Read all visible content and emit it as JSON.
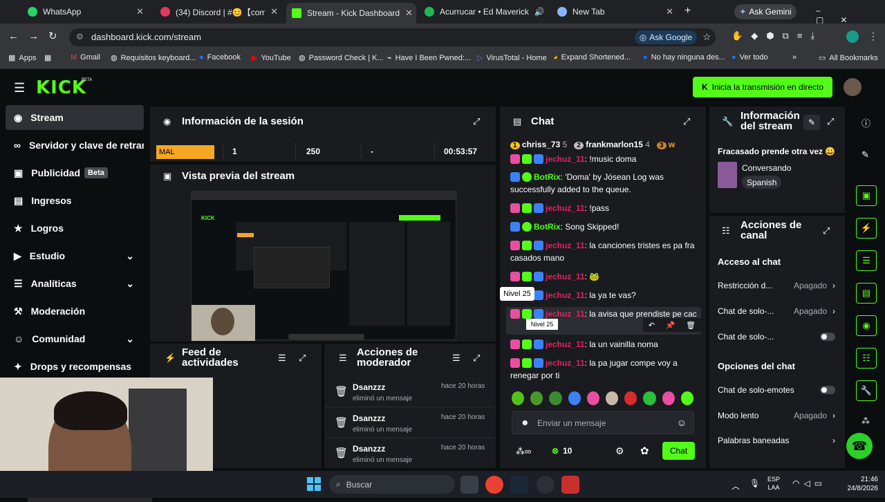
{
  "tabs": [
    {
      "title": "WhatsApp",
      "color": "#25d366"
    },
    {
      "title": "(34) Discord | #😊【comunid",
      "color": "#e2395b"
    },
    {
      "title": "Stream - Kick Dashboard",
      "color": "#53fc18"
    },
    {
      "title": "Acurrucar • Ed Maverick",
      "color": "#1db954"
    },
    {
      "title": "New Tab",
      "color": "#8ab4f8"
    }
  ],
  "ask_gemini": "Ask Gemini",
  "url": "dashboard.kick.com/stream",
  "ask_google": "Ask Google",
  "bookmarks": [
    "Apps",
    "Gmail",
    "Requisitos keyboard...",
    "Facebook",
    "YouTube",
    "Password Check | K...",
    "Have I Been Pwned:...",
    "VirusTotal - Home",
    "Expand Shortened...",
    "No hay ninguna des...",
    "Ver todo"
  ],
  "all_bookmarks": "All Bookmarks",
  "kick_logo": "KICK",
  "beta_tag": "BETA",
  "go_live": "Inicia la transmisión en directo",
  "sidebar": [
    {
      "label": "Stream",
      "icon": "stream-icon",
      "glyph": "◉"
    },
    {
      "label": "Servidor y clave de retransmisi",
      "icon": "link-icon",
      "glyph": "∞"
    },
    {
      "label": "Publicidad",
      "icon": "ad-icon",
      "glyph": "▣",
      "badge": "Beta"
    },
    {
      "label": "Ingresos",
      "icon": "revenue-icon",
      "glyph": "▤"
    },
    {
      "label": "Logros",
      "icon": "trophy-icon",
      "glyph": "★"
    },
    {
      "label": "Estudio",
      "icon": "studio-icon",
      "glyph": "▶"
    },
    {
      "label": "Analíticas",
      "icon": "analytics-icon",
      "glyph": "☰"
    },
    {
      "label": "Moderación",
      "icon": "moderation-icon",
      "glyph": "⚒"
    },
    {
      "label": "Comunidad",
      "icon": "community-icon",
      "glyph": "☺"
    },
    {
      "label": "Drops y recompensas",
      "icon": "gift-icon",
      "glyph": "✦"
    }
  ],
  "session": {
    "title": "Información de la sesión",
    "quality": "MAL",
    "viewers": "1",
    "followers": "250",
    "subs": "-",
    "uptime": "00:53:57"
  },
  "preview": {
    "title": "Vista previa del stream"
  },
  "feed": {
    "title1": "Feed de",
    "title2": "actividades"
  },
  "modactions": {
    "title1": "Acciones de",
    "title2": "moderador",
    "items": [
      {
        "user": "Dsanzzz",
        "action": "eliminó un mensaje",
        "time": "hace 20 horas"
      },
      {
        "user": "Dsanzzz",
        "action": "eliminó un mensaje",
        "time": "hace 20 horas"
      },
      {
        "user": "Dsanzzz",
        "action": "eliminó un mensaje",
        "time": "hace 20 horas"
      }
    ]
  },
  "chat": {
    "title": "Chat",
    "top": [
      {
        "rank": "1",
        "user": "chriss_73",
        "count": "5"
      },
      {
        "rank": "2",
        "user": "frankmarlon15",
        "count": "4"
      },
      {
        "rank": "3",
        "user": "w"
      }
    ],
    "messages": [
      {
        "user": "jechuz_11",
        "text": ": !music doma"
      },
      {
        "user": "BotRix",
        "text": ": 'Doma' by Jósean Log was successfully added to the queue.",
        "bot": true
      },
      {
        "user": "jechuz_11",
        "text": ": !pass"
      },
      {
        "user": "BotRix",
        "text": ": Song Skipped!",
        "bot": true
      },
      {
        "user": "jechuz_11",
        "text": ": la canciones tristes es pa fra casados mano"
      },
      {
        "user": "jechuz_11",
        "text": ": 🐸"
      },
      {
        "user": "jechuz_11",
        "text": ": la ya te vas?"
      },
      {
        "user": "jechuz_11",
        "text": ": la avisa que prendiste pe cac"
      },
      {
        "user": "jechuz_11",
        "text": ": la un vainilla noma"
      },
      {
        "user": "jechuz_11",
        "text": ": la pa jugar compe voy a renegar por ti"
      }
    ],
    "tooltip": "Nivel 25",
    "tooltip_small": "Nivel 25",
    "input_placeholder": "Enviar un mensaje",
    "points": "10",
    "send": "Chat"
  },
  "info": {
    "title1": "Información",
    "title2": "del stream",
    "stream_title": "Fracasado prende otra vez 😀",
    "category": "Conversando",
    "language": "Spanish"
  },
  "channel": {
    "title1": "Acciones de",
    "title2": "canal",
    "section1": "Acceso al chat",
    "rows": [
      {
        "label": "Restricción d...",
        "value": "Apagado"
      },
      {
        "label": "Chat de solo-...",
        "value": "Apagado"
      },
      {
        "label": "Chat de solo-..."
      }
    ],
    "section2": "Opciones del chat",
    "rows2": [
      {
        "label": "Chat de solo-emotes"
      },
      {
        "label": "Modo lento",
        "value": "Apagado"
      },
      {
        "label": "Palabras baneadas"
      }
    ]
  },
  "taskbar": {
    "search": "Buscar",
    "lang1": "ESP",
    "lang2": "LAA",
    "time": "21:46",
    "date": "24/8/2026"
  }
}
